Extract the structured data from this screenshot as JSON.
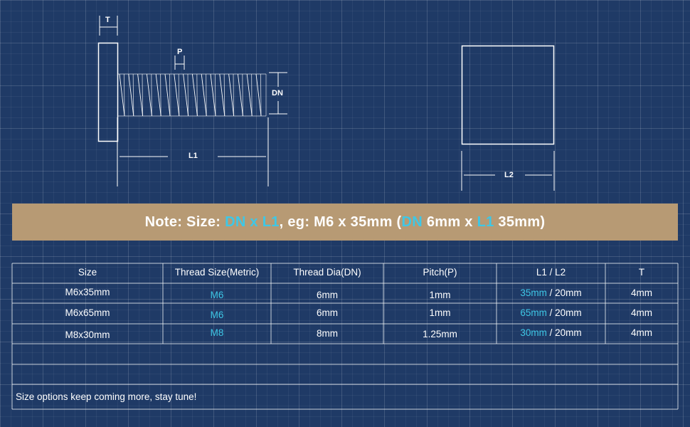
{
  "drawing": {
    "labels": {
      "t": "T",
      "p": "P",
      "dn": "DN",
      "l1": "L1",
      "l2": "L2"
    }
  },
  "note": {
    "parts": [
      {
        "text": "Note: Size: ",
        "highlight": false
      },
      {
        "text": "DN x L1",
        "highlight": true
      },
      {
        "text": ", eg: M6 x 35mm (",
        "highlight": false
      },
      {
        "text": "DN",
        "highlight": true
      },
      {
        "text": " 6mm x ",
        "highlight": false
      },
      {
        "text": "L1",
        "highlight": true
      },
      {
        "text": " 35mm)",
        "highlight": false
      }
    ]
  },
  "table": {
    "headers": [
      "Size",
      "Thread Size(Metric)",
      "Thread Dia(DN)",
      "Pitch(P)",
      "L1 / L2",
      "T"
    ],
    "rows": [
      {
        "size": "M6x35mm",
        "thread": "M6",
        "dia": "6mm",
        "pitch": "1mm",
        "l1": "35mm",
        "l2": " / 20mm",
        "t": "4mm"
      },
      {
        "size": "M6x65mm",
        "thread": "M6",
        "dia": "6mm",
        "pitch": "1mm",
        "l1": "65mm",
        "l2": " / 20mm",
        "t": "4mm"
      },
      {
        "size": "M8x30mm",
        "thread": "M8",
        "dia": "8mm",
        "pitch": "1.25mm",
        "l1": "30mm",
        "l2": " / 20mm",
        "t": "4mm"
      }
    ]
  },
  "footnote": "Size options keep coming more, stay tune!",
  "colors": {
    "background": "#1f3a66",
    "banner": "#b79a74",
    "accent": "#3ec7e6"
  }
}
